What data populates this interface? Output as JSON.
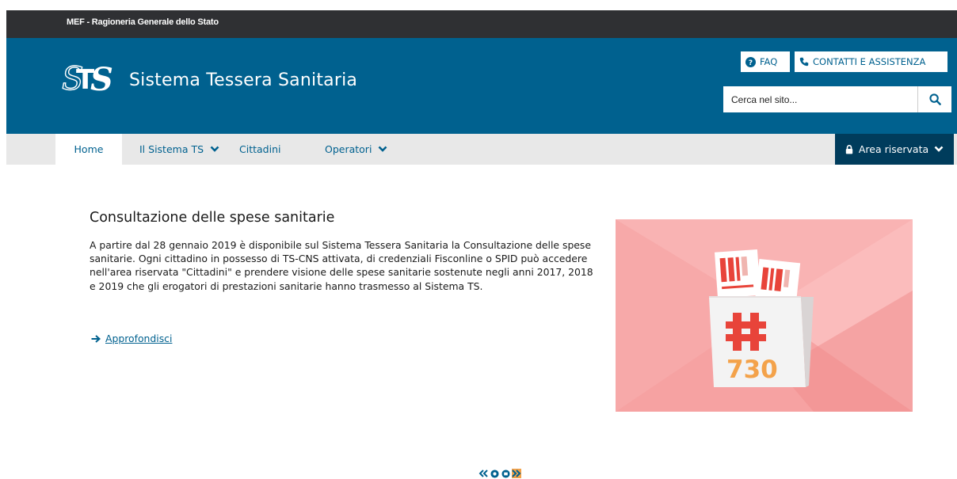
{
  "topbar": {
    "label": "MEF - Ragioneria Generale dello Stato"
  },
  "header": {
    "site_title": "Sistema Tessera Sanitaria",
    "faq_label": "FAQ",
    "contact_label": "CONTATTI E ASSISTENZA",
    "search_placeholder": "Cerca nel sito..."
  },
  "nav": {
    "items": [
      {
        "label": "Home"
      },
      {
        "label": "Il Sistema TS"
      },
      {
        "label": "Cittadini"
      },
      {
        "label": "Operatori"
      }
    ],
    "area_riservata": "Area riservata"
  },
  "article": {
    "title": "Consultazione delle spese sanitarie",
    "body": "A partire dal 28 gennaio 2019 è disponibile sul Sistema Tessera Sanitaria la Consultazione delle spese sanitarie. Ogni cittadino in possesso di TS-CNS attivata, di credenziali Fisconline o SPID può accedere nell'area riservata \"Cittadini\" e prendere visione delle spese sanitarie sostenute negli anni 2017, 2018 e 2019 che gli erogatori di prestazioni sanitarie hanno trasmesso al Sistema TS.",
    "link_label": "Approfondisci"
  },
  "hero": {
    "bag_number": "730"
  },
  "colors": {
    "brand_blue": "#00618f",
    "dark_blue": "#003c5c",
    "topbar": "#2f3033",
    "hero_bg": "#f9b3b3",
    "accent_red": "#e8443a",
    "accent_orange": "#f3a24a"
  }
}
